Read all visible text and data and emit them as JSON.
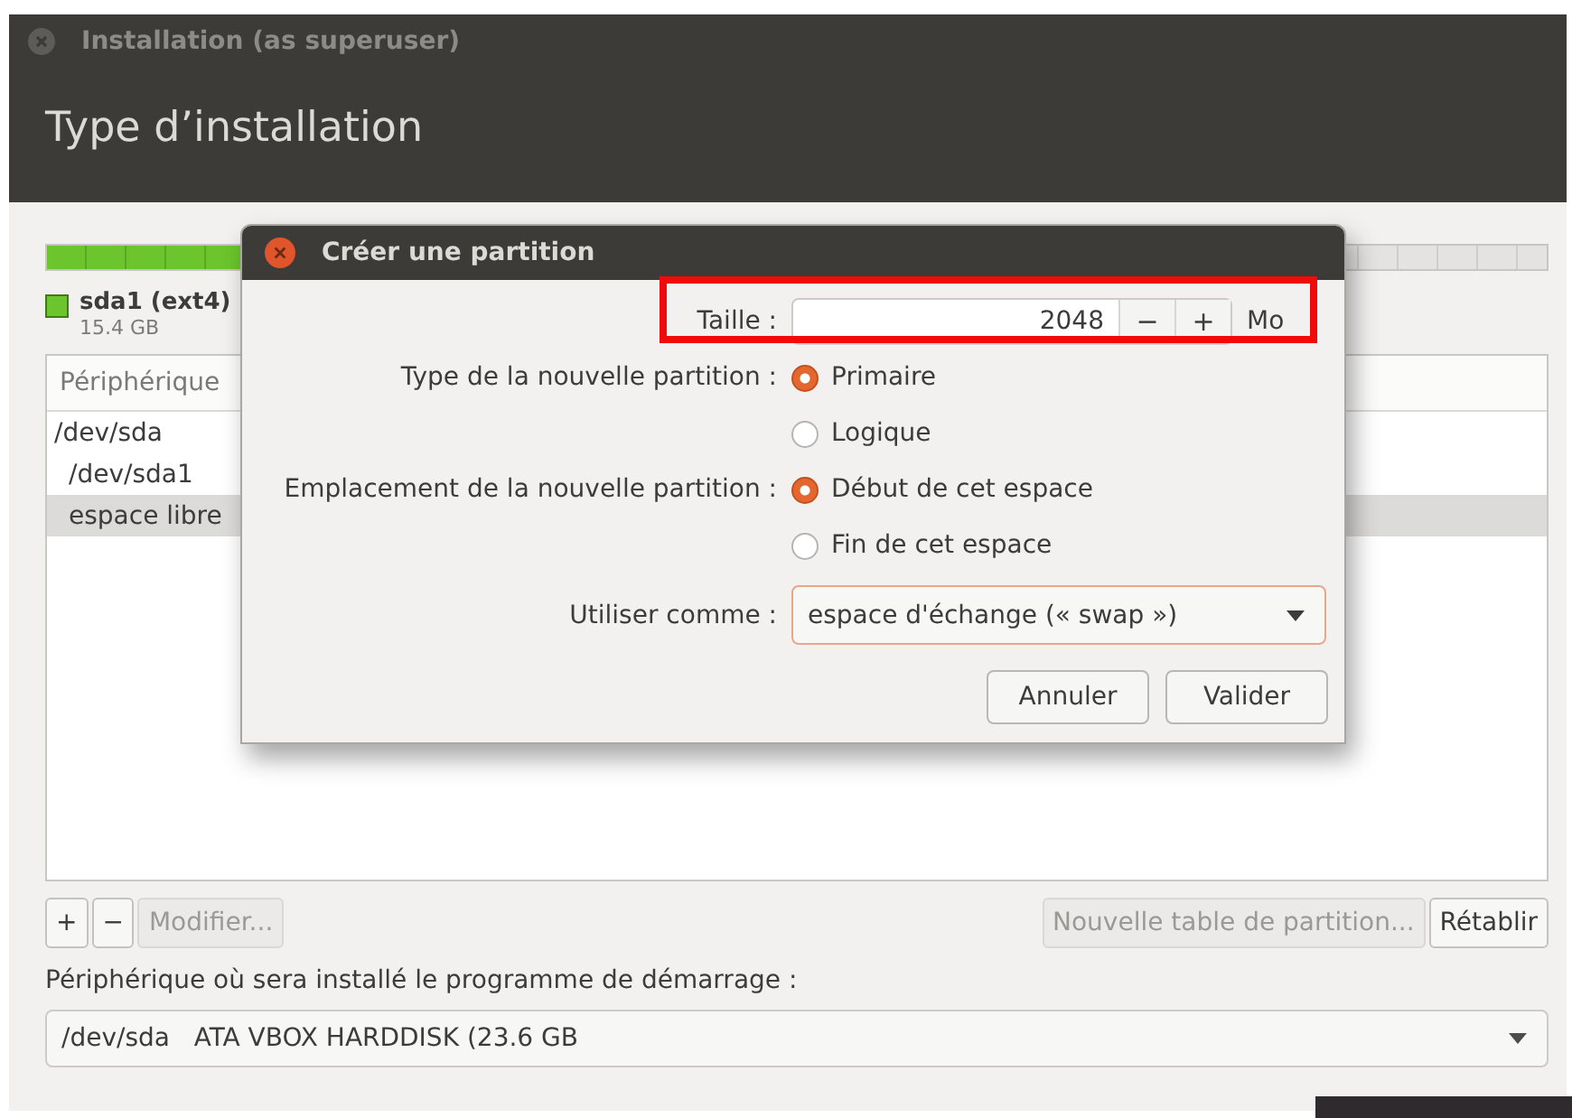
{
  "window": {
    "title": "Installation (as superuser)",
    "heading": "Type d’installation"
  },
  "partition_bar": {
    "level": 0.65
  },
  "legend": [
    {
      "name": "sda1 (ext4)",
      "size": "15.4 GB",
      "color": "#6cc52c"
    }
  ],
  "table": {
    "columns": [
      "Périphérique"
    ],
    "rows": [
      {
        "device": "/dev/sda",
        "selected": false,
        "children": [
          {
            "device": "/dev/sda1",
            "selected": false
          },
          {
            "device": "espace libre",
            "selected": true
          }
        ]
      }
    ]
  },
  "table_buttons": [
    {
      "label": "+",
      "disabled": false
    },
    {
      "label": "−",
      "disabled": false
    },
    {
      "label": "Modifier...",
      "disabled": true
    }
  ],
  "table_buttons_right": [
    {
      "label": "Nouvelle table de partition...",
      "disabled": true
    },
    {
      "label": "Rétablir",
      "disabled": false
    }
  ],
  "bootloader": {
    "label": "Périphérique où sera installé le programme de démarrage :",
    "value": "/dev/sda   ATA VBOX HARDDISK (23.6 GB"
  },
  "dialog": {
    "title": "Créer une partition",
    "size": {
      "label": "Taille :",
      "value": "2048",
      "decrement": "−",
      "increment": "+",
      "unit": "Mo"
    },
    "type": {
      "label": "Type de la nouvelle partition :",
      "options": [
        {
          "label": "Primaire",
          "selected": true
        },
        {
          "label": "Logique",
          "selected": false
        }
      ]
    },
    "location": {
      "label": "Emplacement de la nouvelle partition :",
      "options": [
        {
          "label": "Début de cet espace",
          "selected": true
        },
        {
          "label": "Fin de cet espace",
          "selected": false
        }
      ]
    },
    "use_as": {
      "label": "Utiliser comme :",
      "value": "espace d'échange (« swap »)"
    },
    "buttons": [
      "Annuler",
      "Valider"
    ]
  }
}
